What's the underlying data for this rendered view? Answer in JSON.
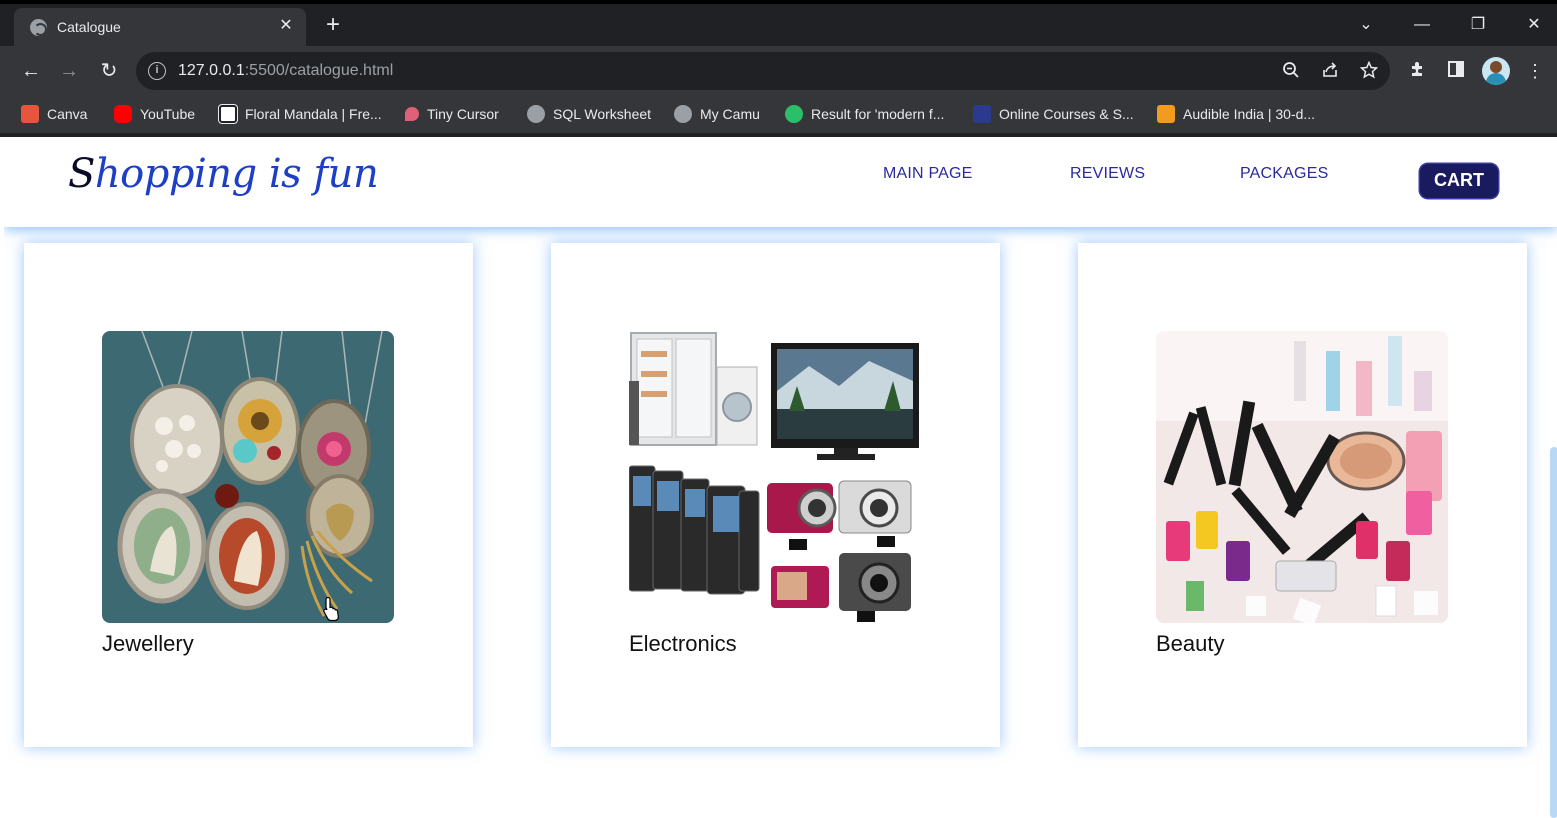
{
  "browser": {
    "tab": {
      "title": "Catalogue",
      "close": "✕"
    },
    "new_tab": "+",
    "window_controls": {
      "dropdown": "⌄",
      "minimize": "—",
      "restore": "❐",
      "close": "✕"
    },
    "nav": {
      "back": "←",
      "forward": "→",
      "reload": "↻"
    },
    "url": {
      "host": "127.0.0.1",
      "rest": ":5500/catalogue.html"
    },
    "bookmarks": [
      {
        "label": "Canva",
        "color": "#e8553e"
      },
      {
        "label": "YouTube",
        "color": "#ff0000"
      },
      {
        "label": "Floral Mandala | Fre...",
        "color": "#ffffff"
      },
      {
        "label": "Tiny Cursor",
        "color": "#e0607a"
      },
      {
        "label": "SQL Worksheet",
        "color": "#9aa0a6"
      },
      {
        "label": "My Camu",
        "color": "#9aa0a6"
      },
      {
        "label": "Result for 'modern f...",
        "color": "#2bbf6a"
      },
      {
        "label": "Online Courses & S...",
        "color": "#2b3a8f"
      },
      {
        "label": "Audible India | 30-d...",
        "color": "#f29c1f"
      }
    ]
  },
  "site": {
    "logo": {
      "first": "S",
      "rest": "hopping is fun"
    },
    "nav": {
      "main_page": "MAIN PAGE",
      "reviews": "REVIEWS",
      "packages": "PACKAGES",
      "cart": "CART"
    },
    "categories": [
      {
        "label": "Jewellery"
      },
      {
        "label": "Electronics"
      },
      {
        "label": "Beauty"
      }
    ]
  },
  "colors": {
    "accent": "#1d3fc6",
    "nav_text": "#2a2a9a",
    "cart_bg": "#1a1a5e",
    "glow": "#5096ff"
  }
}
